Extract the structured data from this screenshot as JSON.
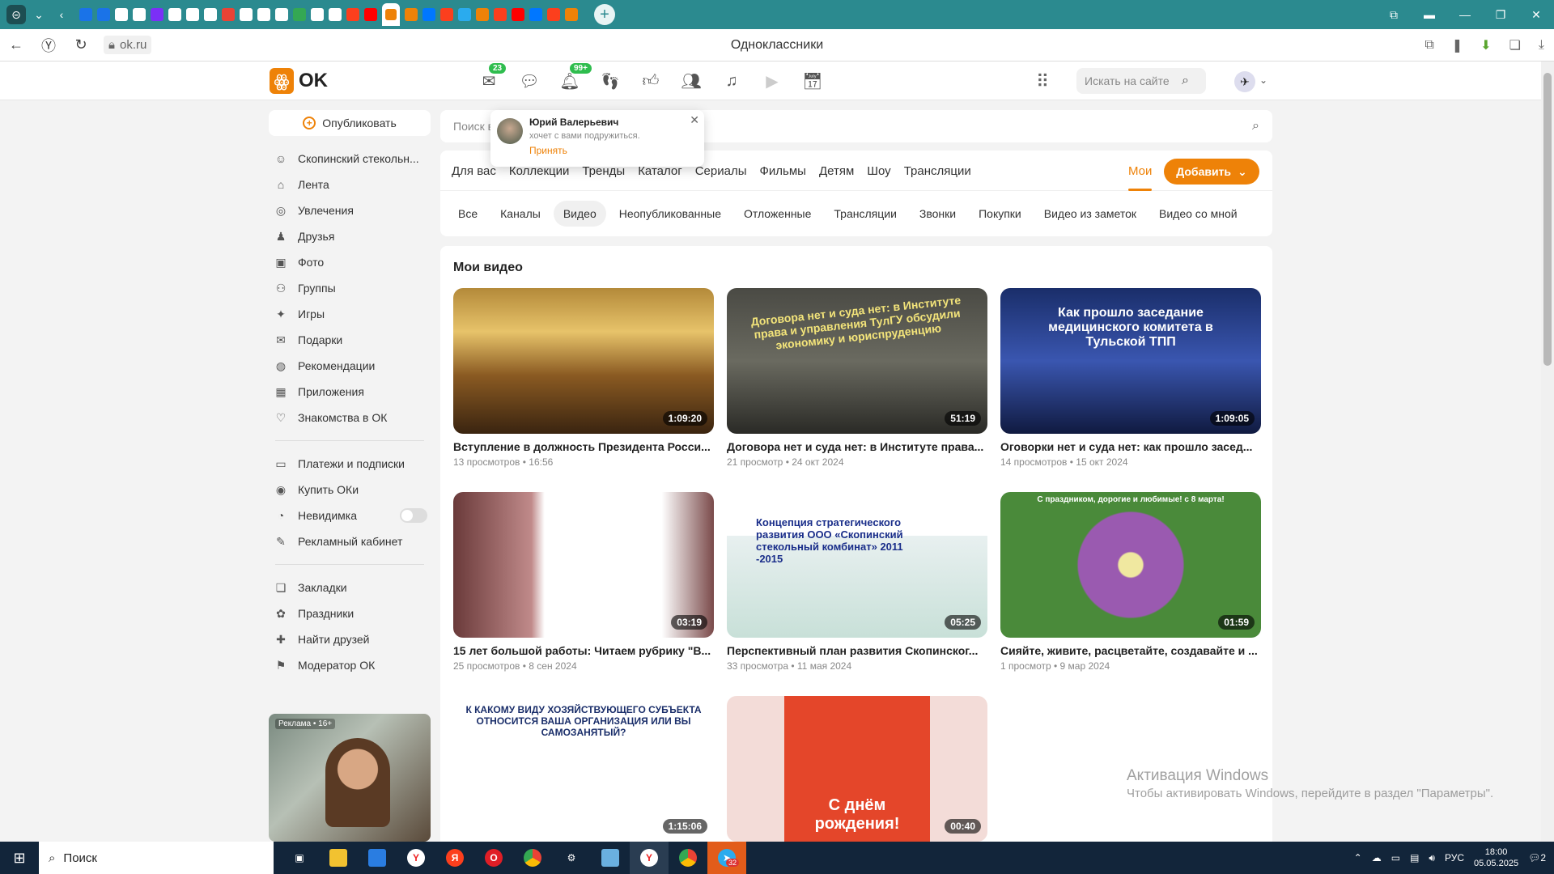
{
  "browser": {
    "url": "ok.ru",
    "page_title": "Одноклассники",
    "tab_favicons": [
      {
        "name": "mail-icon",
        "color": "#1a73e8"
      },
      {
        "name": "mail-icon",
        "color": "#1a73e8"
      },
      {
        "name": "doc-icon",
        "color": "#ffffff"
      },
      {
        "name": "doc-icon",
        "color": "#ffffff"
      },
      {
        "name": "iz-icon",
        "color": "#7b2ff7"
      },
      {
        "name": "doc-icon",
        "color": "#ffffff"
      },
      {
        "name": "doc-icon",
        "color": "#ffffff"
      },
      {
        "name": "doc-icon",
        "color": "#ffffff"
      },
      {
        "name": "gmail-icon",
        "color": "#ea4335"
      },
      {
        "name": "ring-icon",
        "color": "#ffffff"
      },
      {
        "name": "ring-icon",
        "color": "#ffffff"
      },
      {
        "name": "ring-icon",
        "color": "#ffffff"
      },
      {
        "name": "map-icon",
        "color": "#34a853"
      },
      {
        "name": "doc-icon",
        "color": "#ffffff"
      },
      {
        "name": "doc-icon",
        "color": "#ffffff"
      },
      {
        "name": "yandex-icon",
        "color": "#fc3f1d"
      },
      {
        "name": "youtube-icon",
        "color": "#ff0000"
      },
      {
        "name": "ok-icon",
        "color": "#ee8208"
      },
      {
        "name": "vk-icon",
        "color": "#0077ff"
      },
      {
        "name": "yandex-icon",
        "color": "#fc3f1d"
      },
      {
        "name": "telegram-icon",
        "color": "#2aabee"
      },
      {
        "name": "ok-icon",
        "color": "#ee8208"
      },
      {
        "name": "yandex-icon",
        "color": "#fc3f1d"
      },
      {
        "name": "youtube-icon",
        "color": "#ff0000"
      },
      {
        "name": "vk-icon",
        "color": "#0077ff"
      },
      {
        "name": "yandex-icon",
        "color": "#fc3f1d"
      },
      {
        "name": "ok-icon",
        "color": "#ee8208"
      }
    ]
  },
  "header": {
    "logo_text": "OK",
    "messages_badge": "23",
    "notifications_badge": "99+",
    "search_placeholder": "Искать на сайте"
  },
  "sidebar": {
    "publish_label": "Опубликовать",
    "groups": [
      [
        {
          "icon": "profile-icon",
          "glyph": "☺",
          "label": "Скопинский стекольн..."
        },
        {
          "icon": "feed-icon",
          "glyph": "⌂",
          "label": "Лента"
        },
        {
          "icon": "hobby-icon",
          "glyph": "◎",
          "label": "Увлечения"
        },
        {
          "icon": "friends-icon",
          "glyph": "♟",
          "label": "Друзья"
        },
        {
          "icon": "photo-icon",
          "glyph": "▣",
          "label": "Фото"
        },
        {
          "icon": "groups-icon",
          "glyph": "⚇",
          "label": "Группы"
        },
        {
          "icon": "games-icon",
          "glyph": "✦",
          "label": "Игры"
        },
        {
          "icon": "gifts-icon",
          "glyph": "✉",
          "label": "Подарки"
        },
        {
          "icon": "recommend-icon",
          "glyph": "◍",
          "label": "Рекомендации"
        },
        {
          "icon": "apps-icon",
          "glyph": "▦",
          "label": "Приложения"
        },
        {
          "icon": "dating-icon",
          "glyph": "♡",
          "label": "Знакомства в ОК"
        }
      ],
      [
        {
          "icon": "payments-icon",
          "glyph": "▭",
          "label": "Платежи и подписки"
        },
        {
          "icon": "ok-coin-icon",
          "glyph": "◉",
          "label": "Купить ОКи"
        },
        {
          "icon": "invisible-icon",
          "glyph": "◔",
          "label": "Невидимка",
          "toggle": true
        },
        {
          "icon": "ads-cabinet-icon",
          "glyph": "✎",
          "label": "Рекламный кабинет"
        }
      ],
      [
        {
          "icon": "bookmark-icon",
          "glyph": "❏",
          "label": "Закладки"
        },
        {
          "icon": "holiday-icon",
          "glyph": "✿",
          "label": "Праздники"
        },
        {
          "icon": "find-friends-icon",
          "glyph": "✚",
          "label": "Найти друзей"
        },
        {
          "icon": "moderator-icon",
          "glyph": "⚑",
          "label": "Модератор ОК"
        }
      ]
    ],
    "ad_label": "Реклама • 16+"
  },
  "friend_request": {
    "name": "Юрий Валерьевич",
    "message": "хочет с вами подружиться.",
    "accept": "Принять"
  },
  "main": {
    "search_placeholder": "Поиск в",
    "tabs": [
      "Для вас",
      "Коллекции",
      "Тренды",
      "Каталог",
      "Сериалы",
      "Фильмы",
      "Детям",
      "Шоу",
      "Трансляции"
    ],
    "mine_tab": "Мои",
    "add_button": "Добавить",
    "sub_tabs": [
      "Все",
      "Каналы",
      "Видео",
      "Неопубликованные",
      "Отложенные",
      "Трансляции",
      "Звонки",
      "Покупки",
      "Видео из заметок",
      "Видео со мной"
    ],
    "selected_sub_tab": "Видео",
    "section_title": "Мои видео",
    "videos": [
      {
        "title": "Вступление в должность Президента Росси...",
        "meta": "13 просмотров • 16:56",
        "duration": "1:09:20",
        "thumb_class": "t1",
        "overlay": ""
      },
      {
        "title": "Договора нет и суда нет: в Институте права...",
        "meta": "21 просмотр • 24 окт 2024",
        "duration": "51:19",
        "thumb_class": "t2",
        "overlay": "Договора нет и суда нет: в Институте права и управления ТулГУ обсудили экономику и юриспруденцию"
      },
      {
        "title": "Оговорки нет и суда нет: как прошло засед...",
        "meta": "14 просмотров • 15 окт 2024",
        "duration": "1:09:05",
        "thumb_class": "t3",
        "overlay": "Как прошло заседание медицинского комитета в Тульской ТПП"
      },
      {
        "title": "15 лет большой работы: Читаем рубрику \"В...",
        "meta": "25 просмотров • 8 сен 2024",
        "duration": "03:19",
        "thumb_class": "t4",
        "overlay": ""
      },
      {
        "title": "Перспективный план развития Скопинског...",
        "meta": "33 просмотра • 11 мая 2024",
        "duration": "05:25",
        "thumb_class": "t5",
        "overlay": "Концепция стратегического развития ООО «Скопинский стекольный комбинат» 2011 -2015"
      },
      {
        "title": "Сияйте, живите, расцветайте, создавайте и ...",
        "meta": "1 просмотр • 9 мар 2024",
        "duration": "01:59",
        "thumb_class": "t6",
        "overlay": "С праздником, дорогие и любимые! с 8 марта!"
      },
      {
        "title": "",
        "meta": "",
        "duration": "1:15:06",
        "thumb_class": "t7",
        "overlay": "К КАКОМУ ВИДУ ХОЗЯЙСТВУЮЩЕГО СУБЪЕКТА ОТНОСИТСЯ ВАША ОРГАНИЗАЦИЯ ИЛИ ВЫ САМОЗАНЯТЫЙ?"
      },
      {
        "title": "",
        "meta": "",
        "duration": "00:40",
        "thumb_class": "t8",
        "overlay": "С днём рождения!"
      }
    ]
  },
  "watermark": {
    "line1": "Активация Windows",
    "line2": "Чтобы активировать Windows, перейдите в раздел \"Параметры\"."
  },
  "taskbar": {
    "search_label": "Поиск",
    "language": "РУС",
    "time": "18:00",
    "date": "05.05.2025",
    "notifications": "2",
    "telegram_badge": "32"
  }
}
